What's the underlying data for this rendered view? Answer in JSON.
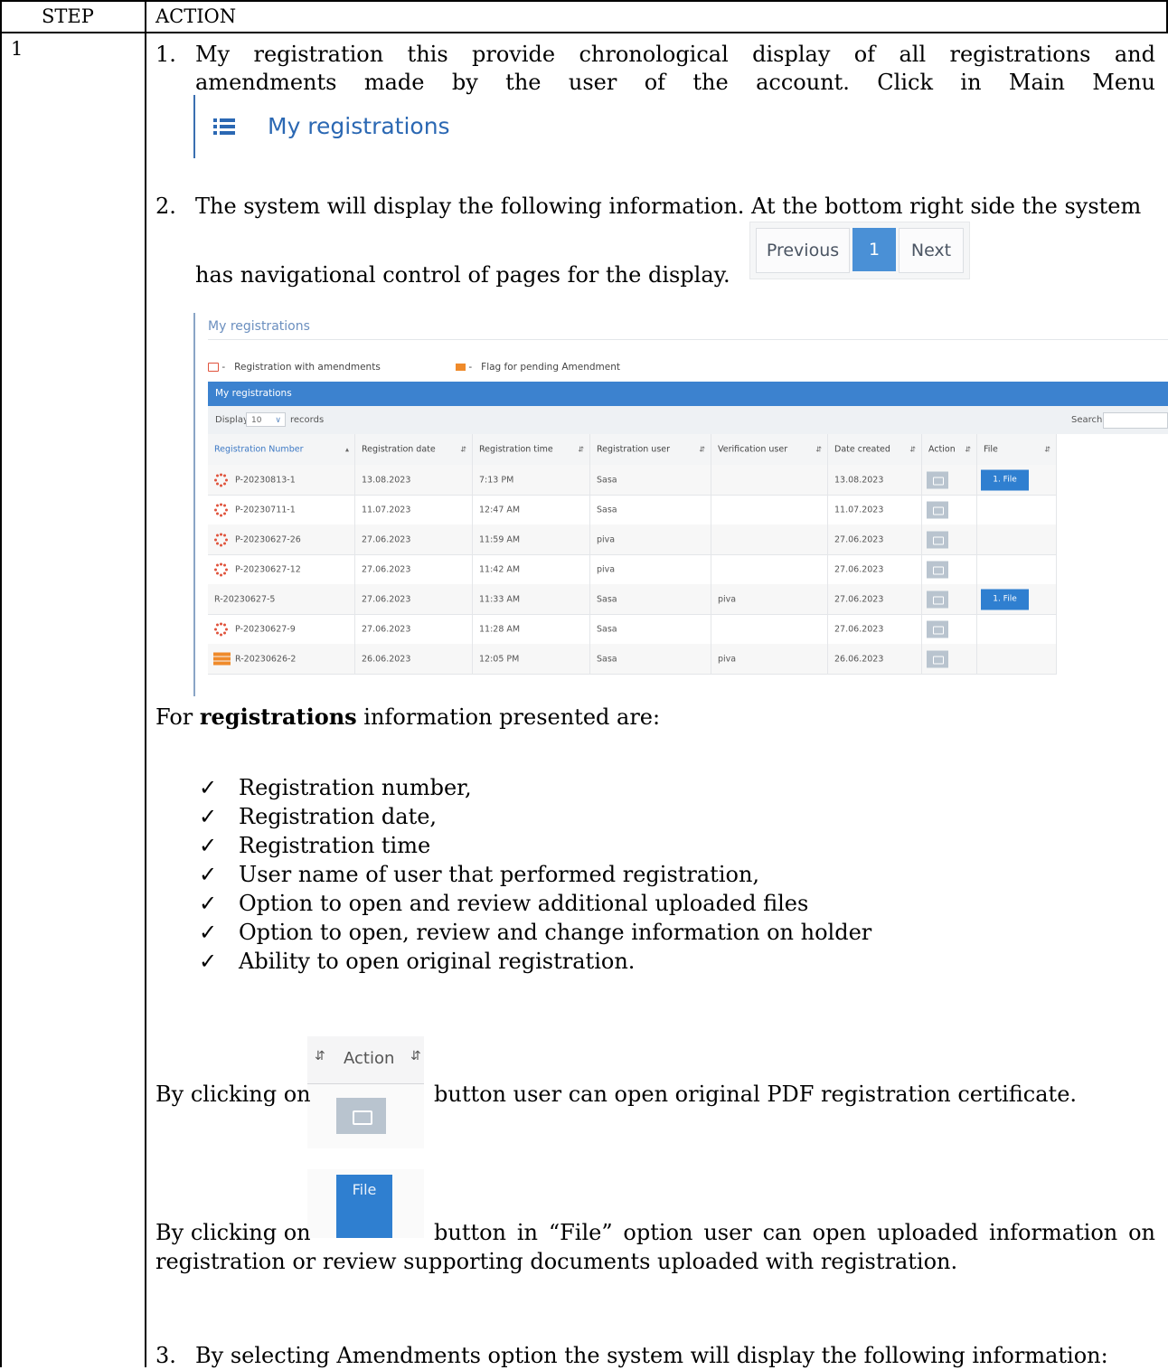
{
  "table_header": {
    "step": "STEP",
    "action": "ACTION"
  },
  "step_number": "1",
  "item1": {
    "number": "1.",
    "line1": "My registration this provide chronological display of all registrations and",
    "line2": "amendments made by the user of the account. Click in Main Menu"
  },
  "menu_snippet": {
    "label": "My registrations",
    "icon": "list-icon"
  },
  "item2": {
    "number": "2.",
    "line1": "The system will display the following information. At the bottom right side the system",
    "line2": "has navigational control of pages for the display."
  },
  "pager": {
    "previous": "Previous",
    "current": "1",
    "next": "Next"
  },
  "screenshot": {
    "page_title": "My registrations",
    "legend": [
      {
        "icon": "edit-icon",
        "color": "#e0533c",
        "text": "Registration with amendments"
      },
      {
        "icon": "flag-icon",
        "color": "#ef8a2a",
        "text": "Flag for pending Amendment"
      }
    ],
    "panel_title": "My registrations",
    "display_label": "Display",
    "display_value": "10",
    "records_label": "records",
    "search_label": "Search:",
    "columns": [
      "Registration Number",
      "Registration date",
      "Registration time",
      "Registration user",
      "Verification user",
      "Date created",
      "Action",
      "File"
    ],
    "rows": [
      {
        "icon": "pending",
        "number": "P-20230813-1",
        "date": "13.08.2023",
        "time": "7:13 PM",
        "user": "Sasa",
        "verifier": "",
        "created": "13.08.2023",
        "file": "1. File"
      },
      {
        "icon": "pending",
        "number": "P-20230711-1",
        "date": "11.07.2023",
        "time": "12:47 AM",
        "user": "Sasa",
        "verifier": "",
        "created": "11.07.2023",
        "file": ""
      },
      {
        "icon": "pending",
        "number": "P-20230627-26",
        "date": "27.06.2023",
        "time": "11:59 AM",
        "user": "piva",
        "verifier": "",
        "created": "27.06.2023",
        "file": ""
      },
      {
        "icon": "pending",
        "number": "P-20230627-12",
        "date": "27.06.2023",
        "time": "11:42 AM",
        "user": "piva",
        "verifier": "",
        "created": "27.06.2023",
        "file": ""
      },
      {
        "icon": "",
        "number": "R-20230627-5",
        "date": "27.06.2023",
        "time": "11:33 AM",
        "user": "Sasa",
        "verifier": "piva",
        "created": "27.06.2023",
        "file": "1. File"
      },
      {
        "icon": "pending",
        "number": "P-20230627-9",
        "date": "27.06.2023",
        "time": "11:28 AM",
        "user": "Sasa",
        "verifier": "",
        "created": "27.06.2023",
        "file": ""
      },
      {
        "icon": "flag",
        "number": "R-20230626-2",
        "date": "26.06.2023",
        "time": "12:05 PM",
        "user": "Sasa",
        "verifier": "piva",
        "created": "26.06.2023",
        "file": ""
      }
    ]
  },
  "registrations_intro": {
    "pre": "For ",
    "bold": "registrations",
    "post": " information presented are:"
  },
  "checklist": [
    "Registration number,",
    "Registration date,",
    "Registration time",
    "User name of user that performed registration,",
    "Option to open and review additional uploaded files",
    "Option to open, review and change information on holder",
    "Ability to open original registration."
  ],
  "check_mark": "✓",
  "action_snippet": {
    "label": "Action"
  },
  "action_sentence": {
    "pre": "By clicking on",
    "post": "button user can open original PDF registration certificate."
  },
  "file_snippet": {
    "label": "File"
  },
  "file_sentence": {
    "pre": "By clicking on",
    "post": "button in  “File” option user can open uploaded information on",
    "line2": "registration or review supporting documents uploaded with registration."
  },
  "item3": {
    "number": "3.",
    "line1": "By selecting Amendments option the system will display the following information:"
  }
}
